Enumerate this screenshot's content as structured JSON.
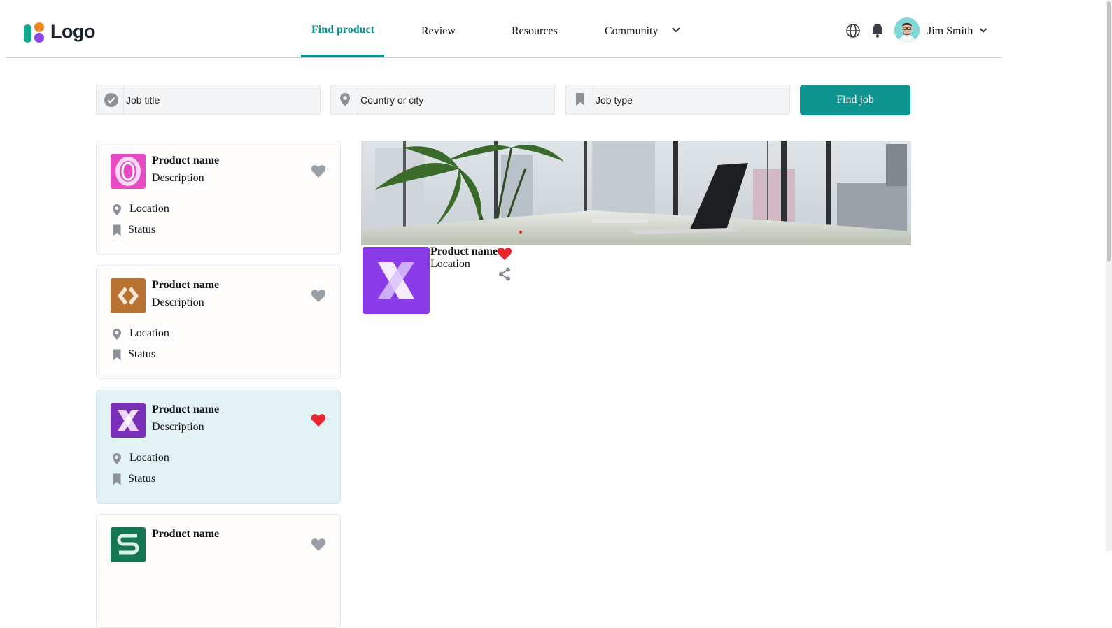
{
  "header": {
    "logo_text": "Logo",
    "nav": [
      {
        "label": "Find product",
        "active": true
      },
      {
        "label": "Review"
      },
      {
        "label": "Resources"
      },
      {
        "label": "Community",
        "has_dropdown": true
      }
    ],
    "user_name": "Jim Smith",
    "accent_color": "#0e8f8c"
  },
  "search": {
    "job_title": "Job title",
    "location": "Country or city",
    "job_type": "Job type",
    "button_label": "Find job",
    "button_color": "#0e9590"
  },
  "cards": [
    {
      "name": "Product name",
      "description": "Description",
      "location": "Location",
      "status": "Status",
      "favorited": false,
      "icon": "pink-o-logo"
    },
    {
      "name": "Product name",
      "description": "Description",
      "location": "Location",
      "status": "Status",
      "favorited": false,
      "icon": "orange-brackets-logo"
    },
    {
      "name": "Product name",
      "description": "Description",
      "location": "Location",
      "status": "Status",
      "favorited": true,
      "selected": true,
      "icon": "purple-x-logo"
    },
    {
      "name": "Product name",
      "icon": "green-s-logo"
    }
  ],
  "detail": {
    "name": "Product name",
    "location": "Location",
    "favorited": true,
    "banner": "office-interior-photo"
  },
  "colors": {
    "heart_active": "#e8262e",
    "heart_inactive": "#9aa0a8",
    "selected_card": "#e2f2f5"
  }
}
